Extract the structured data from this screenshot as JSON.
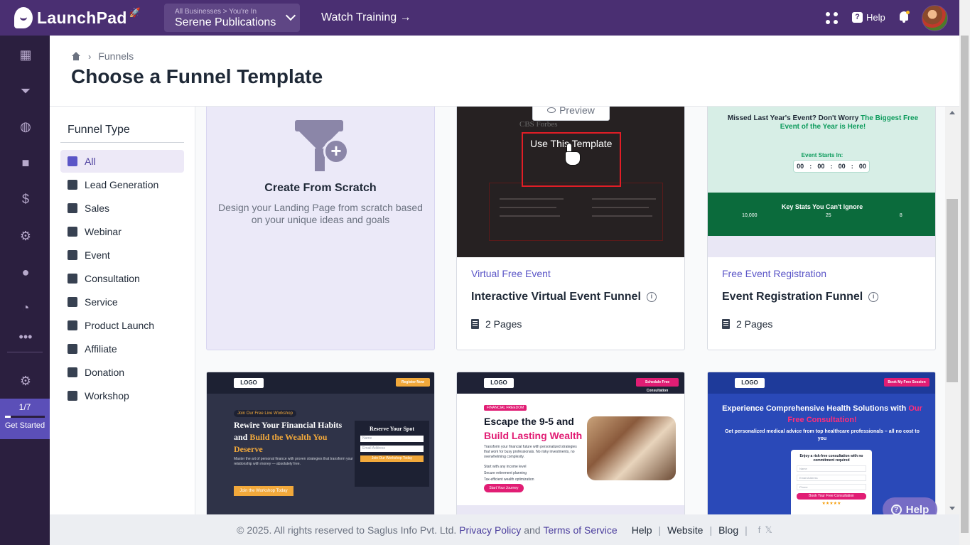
{
  "topbar": {
    "brand": "LaunchPad",
    "business_sub": "All Businesses > You're In",
    "business_name": "Serene Publications",
    "watch_training": "Watch Training →",
    "help": "Help"
  },
  "rail": {
    "icons": [
      "dashboard-icon",
      "funnel-icon",
      "globe-icon",
      "video-icon",
      "dollar-icon",
      "automation-icon",
      "contacts-icon",
      "analytics-icon",
      "more-icon",
      "settings-icon"
    ],
    "progress": "1/7",
    "progress_fraction": 0.14,
    "get_started": "Get Started"
  },
  "header": {
    "breadcrumb": "Funnels",
    "title": "Choose a Funnel Template"
  },
  "filter": {
    "heading": "Funnel Type",
    "items": [
      {
        "label": "All",
        "active": true
      },
      {
        "label": "Lead Generation"
      },
      {
        "label": "Sales"
      },
      {
        "label": "Webinar"
      },
      {
        "label": "Event"
      },
      {
        "label": "Consultation"
      },
      {
        "label": "Service"
      },
      {
        "label": "Product Launch"
      },
      {
        "label": "Affiliate"
      },
      {
        "label": "Donation"
      },
      {
        "label": "Workshop"
      }
    ]
  },
  "scratch": {
    "title": "Create From Scratch",
    "desc": "Design your Landing Page from scratch based on your unique ideas and goals"
  },
  "cards": [
    {
      "category": "Virtual Free Event",
      "name": "Interactive Virtual Event Funnel",
      "pages": "2 Pages",
      "preview": "Preview",
      "use": "Use This Template",
      "logos": "CBS        Forbes"
    },
    {
      "category": "Free Event Registration",
      "name": "Event Registration Funnel",
      "pages": "2 Pages",
      "thumb": {
        "headline_a": "Missed Last Year's Event? Don't Worry ",
        "headline_b": "The Biggest Free Event of the Year is Here!",
        "starts": "Event Starts In:",
        "count": [
          "00",
          "00",
          "00",
          "00"
        ],
        "stats_title": "Key Stats You Can't Ignore",
        "stats": [
          "10,000",
          "25",
          "8"
        ]
      }
    }
  ],
  "row2": [
    {
      "logo": "LOGO",
      "cta": "Register Now",
      "tag": "Join Our Free Live Workshop",
      "h_a": "Rewire Your Financial Habits and ",
      "h_b": "Build the Wealth You Deserve",
      "p": "Master the art of personal finance with proven strategies that transform your relationship with money — absolutely free.",
      "btn": "Join the Workshop Today",
      "form_title": "Reserve Your Spot",
      "f1": "Name",
      "f2": "Email Address",
      "fbtn": "Join Our Workshop Today"
    },
    {
      "logo": "LOGO",
      "cta": "Schedule Free Consultation",
      "tag": "FINANCIAL FREEDOM",
      "h_a": "Escape the 9-5 and ",
      "h_b": "Build Lasting Wealth",
      "p": "Transform your financial future with personalized strategies that work for busy professionals. No risky investments, no overwhelming complexity.",
      "l1": "Start with any income level",
      "l2": "Secure retirement planning",
      "l3": "Tax-efficient wealth optimization",
      "btn": "Start Your Journey"
    },
    {
      "logo": "LOGO",
      "cta": "Book My Free Session",
      "h_a": "Experience Comprehensive Health Solutions with ",
      "h_b": "Our Free Consultation!",
      "sub": "Get personalized medical advice from top healthcare professionals – all no cost to you",
      "form_title": "Enjoy a risk-free consultation with no commitment required",
      "f1": "Name",
      "f2": "Email Address",
      "f3": "Phone",
      "fbtn": "Book Your Free Consultation",
      "stars": "★★★★★"
    }
  ],
  "help_bubble": "Help",
  "footer": {
    "copyright": "©  2025. All rights reserved to Saglus Info Pvt. Ltd.",
    "privacy": "Privacy Policy",
    "and": "and",
    "terms": "Terms of Service",
    "help": "Help",
    "website": "Website",
    "blog": "Blog"
  }
}
